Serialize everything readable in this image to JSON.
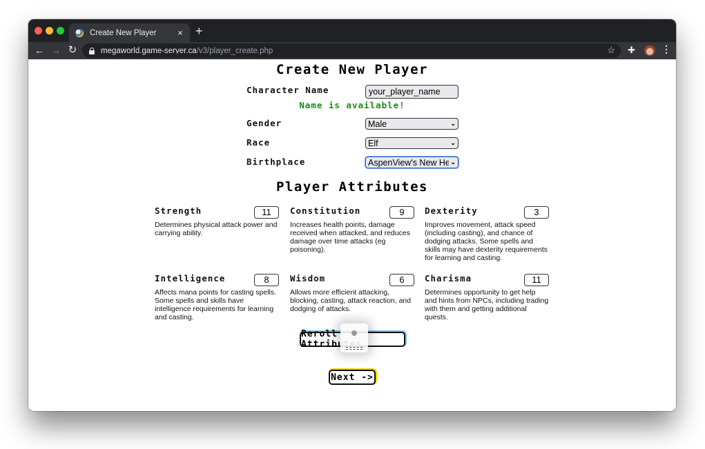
{
  "browser": {
    "tab_title": "Create New Player",
    "tab_close": "×",
    "new_tab": "+",
    "url_host": "megaworld.game-server.ca",
    "url_path": "/v3/player_create.php",
    "nav": {
      "back": "←",
      "forward": "→",
      "reload": "↻"
    },
    "icons": {
      "star": "☆",
      "extensions": "✚",
      "menu": "⋮"
    }
  },
  "page": {
    "title": "Create New Player",
    "form": {
      "character_name": {
        "label": "Character Name",
        "value": "your_player_name"
      },
      "availability_message": "Name is available!",
      "gender": {
        "label": "Gender",
        "selected": "Male"
      },
      "race": {
        "label": "Race",
        "selected": "Elf"
      },
      "birthplace": {
        "label": "Birthplace",
        "selected": "AspenView's New Hero"
      }
    },
    "attributes_title": "Player Attributes",
    "attributes": [
      {
        "name": "Strength",
        "value": "11",
        "description": "Determines physical attack power and carrying ability."
      },
      {
        "name": "Constitution",
        "value": "9",
        "description": "Increases health points, damage received when attacked, and reduces damage over time attacks (eg poisoning)."
      },
      {
        "name": "Dexterity",
        "value": "3",
        "description": "Improves movement, attack speed (including casting), and chance of dodging attacks. Some spells and skills may have dexterity requirements for learning and casting."
      },
      {
        "name": "Intelligence",
        "value": "8",
        "description": "Affects mana points for casting spells. Some spells and skills have intelligence requirements for learning and casting."
      },
      {
        "name": "Wisdom",
        "value": "6",
        "description": "Allows more efficient attacking, blocking, casting, attack reaction, and dodging of attacks."
      },
      {
        "name": "Charisma",
        "value": "11",
        "description": "Determines opportunity to get help and hints from NPCs, including trading with them and getting additional quests."
      }
    ],
    "buttons": {
      "reroll": "Reroll Attributes",
      "next": "Next ->"
    }
  },
  "colors": {
    "available_text": "#1a8a1a",
    "reroll_focus": "#7cc3e6",
    "next_focus": "#f0d200",
    "select_focus": "#2a63c8"
  }
}
